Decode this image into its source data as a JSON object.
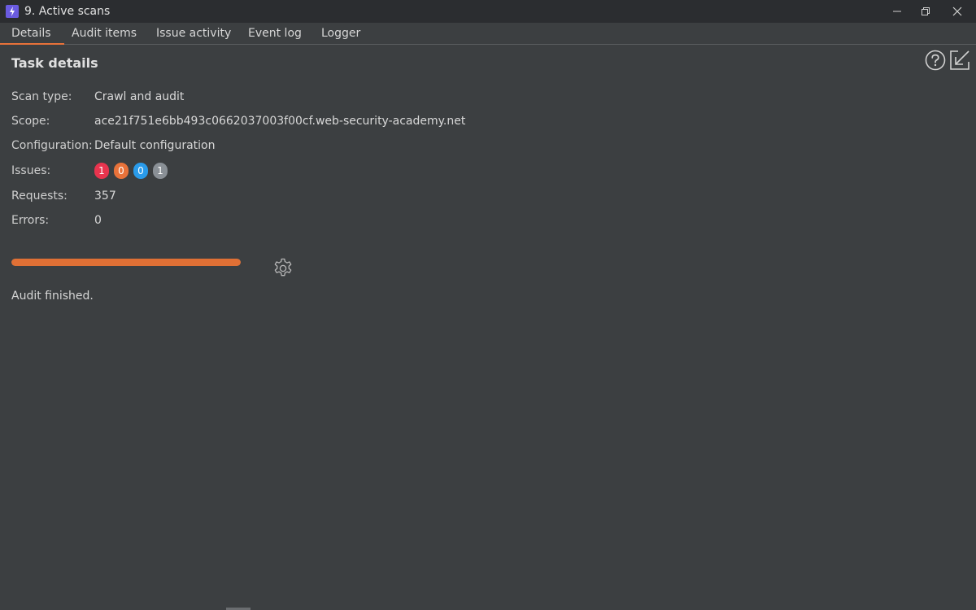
{
  "window": {
    "title": "9. Active scans",
    "icon": "burp-lightning-icon",
    "icon_color": "#6a5be0"
  },
  "tabs": [
    {
      "label": "Details",
      "active": true
    },
    {
      "label": "Audit items",
      "active": false
    },
    {
      "label": "Issue activity",
      "active": false
    },
    {
      "label": "Event log",
      "active": false
    },
    {
      "label": "Logger",
      "active": false
    }
  ],
  "details": {
    "title": "Task details",
    "scan_type_label": "Scan type:",
    "scan_type_value": "Crawl and audit",
    "scope_label": "Scope:",
    "scope_value": "ace21f751e6bb493c0662037003f00cf.web-security-academy.net",
    "configuration_label": "Configuration:",
    "configuration_value": "Default configuration",
    "issues_label": "Issues:",
    "issues": [
      {
        "count": "1",
        "color": "#e8344e"
      },
      {
        "count": "0",
        "color": "#e8723a"
      },
      {
        "count": "0",
        "color": "#2a9bea"
      },
      {
        "count": "1",
        "color": "#8a9096"
      }
    ],
    "requests_label": "Requests:",
    "requests_value": "357",
    "errors_label": "Errors:",
    "errors_value": "0"
  },
  "progress": {
    "fraction": 1.0,
    "color": "#e07035"
  },
  "status": "Audit finished.",
  "accent_color": "#e8723a"
}
